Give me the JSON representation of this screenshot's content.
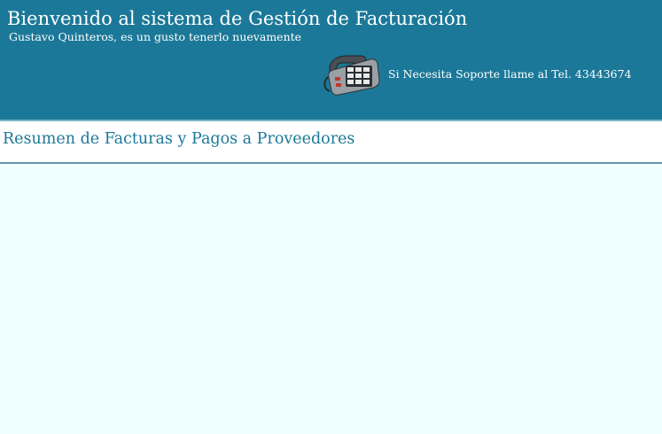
{
  "header": {
    "title": "Bienvenido al sistema de Gestión de Facturación",
    "subtitle": "Gustavo Quinteros, es un gusto tenerlo nuevamente",
    "support_icon": "phone-icon",
    "support_text": "Si Necesita Soporte llame al Tel. 43443674"
  },
  "section": {
    "title": "Resumen de Facturas y Pagos a Proveedores"
  },
  "colors": {
    "header_bg": "#1b7898",
    "page_bg": "#f0ffff",
    "section_title": "#1b7898"
  }
}
